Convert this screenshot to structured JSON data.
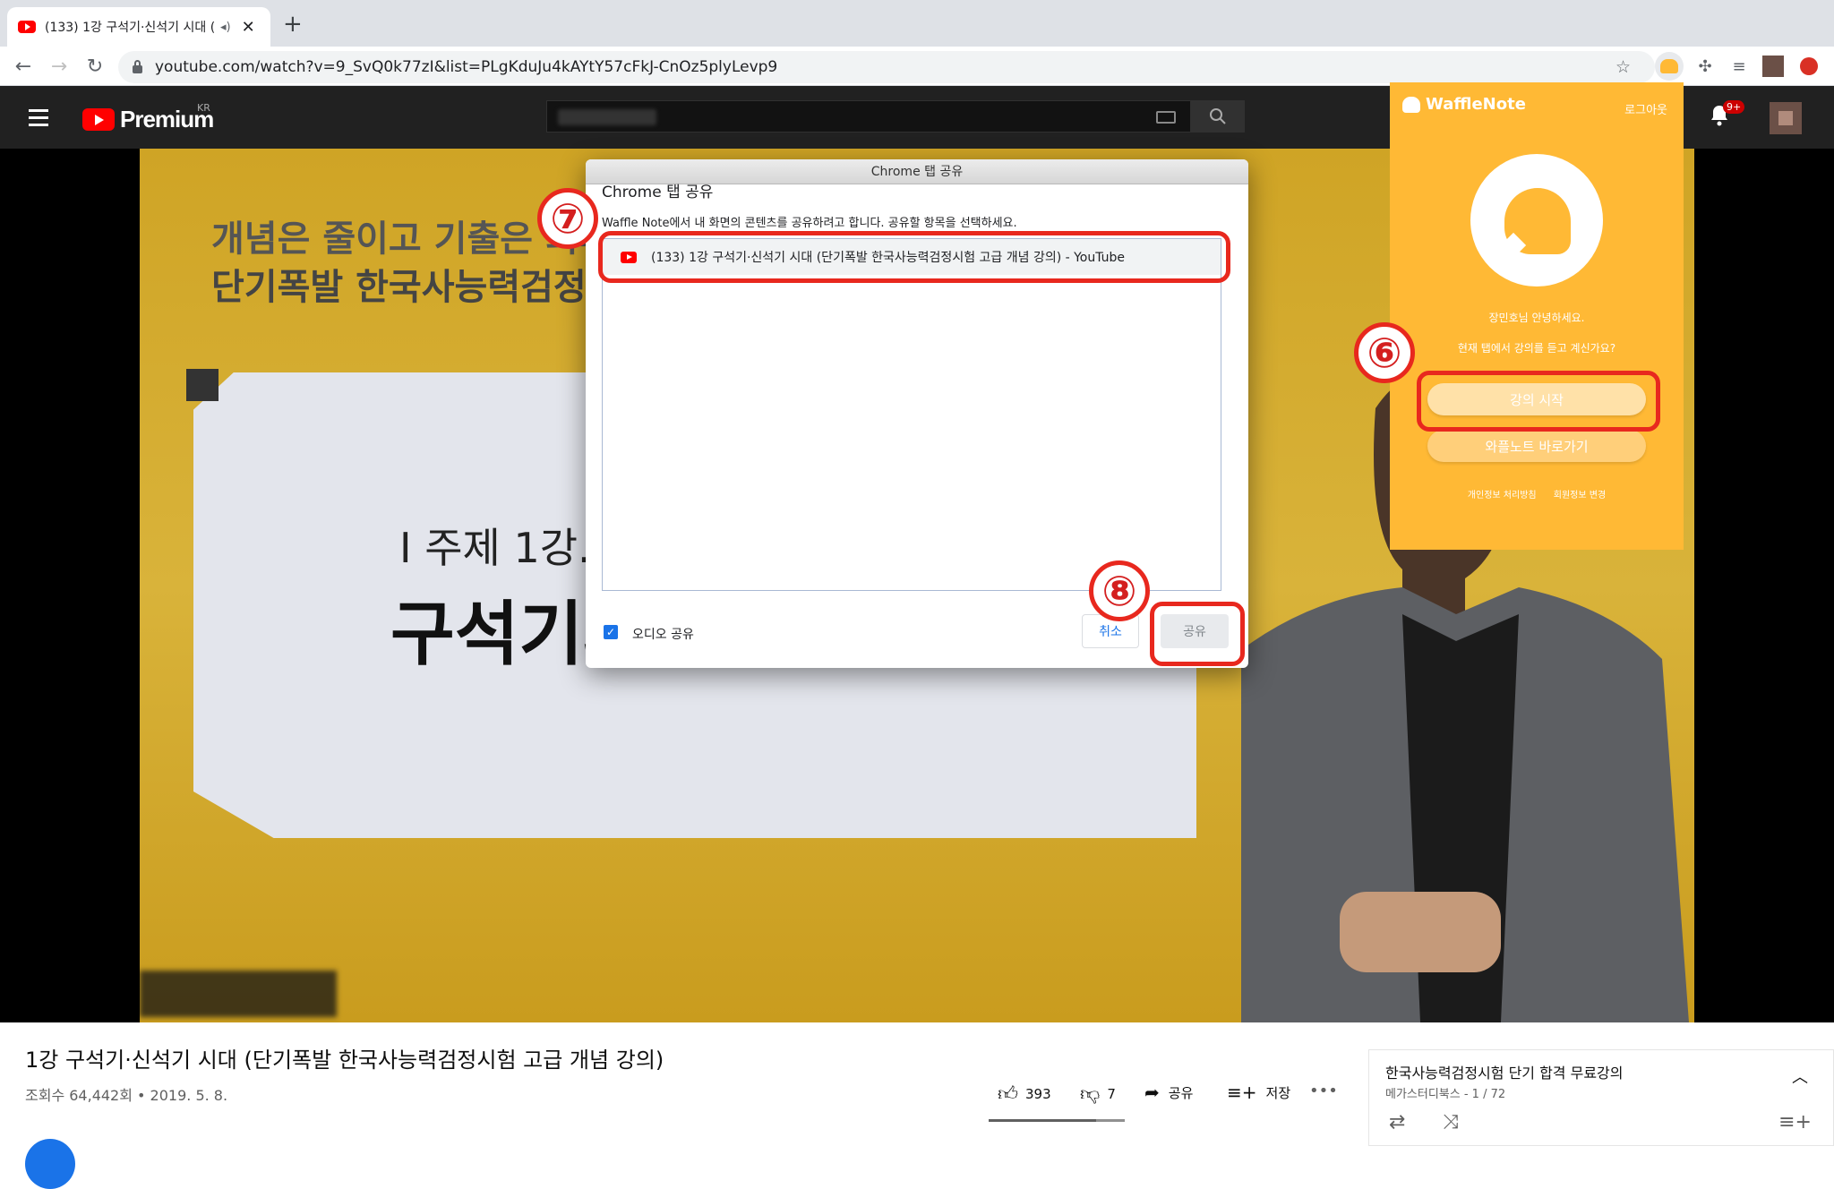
{
  "browser": {
    "tab_title": "(133) 1강 구석기·신석기 시대 (",
    "url_host": "youtube.com",
    "url_path": "/watch?v=9_SvQ0k77zI&list=PLgKduJu4kAYtY57cFkJ-CnOz5plyLevp9"
  },
  "youtube": {
    "logo_text": "Premium",
    "region": "KR",
    "notif_count": "9+"
  },
  "video": {
    "slide_line1": "개념은 줄이고 기출은 최대로",
    "slide_line2": "단기폭발 한국사능력검정시험",
    "board_line1": "I 주제 1강.",
    "board_line2": "구석기와",
    "title": "1강 구석기·신석기 시대 (단기폭발 한국사능력검정시험 고급 개념 강의)",
    "meta": "조회수 64,442회 • 2019. 5. 8.",
    "likes": "393",
    "dislikes": "7",
    "share_label": "공유",
    "save_label": "저장",
    "more": "•••"
  },
  "playlist": {
    "title": "한국사능력검정시험 단기 합격 무료강의",
    "subtitle": "메가스터디북스 - 1 / 72"
  },
  "waffle": {
    "name": "WaffleNote",
    "logout": "로그아웃",
    "greeting": "장민호님 안녕하세요.",
    "question": "현재 탭에서 강의를 듣고 계신가요?",
    "start_button": "강의 시작",
    "go_button": "와플노트 바로가기",
    "privacy": "개인정보 처리방침",
    "profile": "회원정보 변경"
  },
  "dialog": {
    "titlebar": "Chrome 탭 공유",
    "heading": "Chrome 탭 공유",
    "description": "Waffle Note에서 내 화면의 콘텐츠를 공유하려고 합니다. 공유할 항목을 선택하세요.",
    "item_label": "(133) 1강 구석기·신석기 시대 (단기폭발 한국사능력검정시험 고급 개념 강의) - YouTube",
    "audio_label": "오디오 공유",
    "cancel": "취소",
    "share": "공유"
  },
  "annotations": {
    "step6": "⑥",
    "step7": "⑦",
    "step8": "⑧"
  },
  "colors": {
    "annotation_red": "#e8281e",
    "waffle_orange": "#ffb935",
    "chrome_blue": "#1a73e8"
  }
}
